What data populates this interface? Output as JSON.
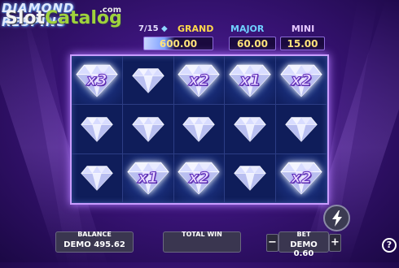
{
  "logo": {
    "game_title": "DIAMOND RESPINS",
    "watermark_part1": "Slot",
    "watermark_part2": "Catalog",
    "watermark_domain": ".com"
  },
  "jackpots": {
    "counter_current": "7/15",
    "counter_icon": "diamond-icon",
    "grand_label": "GRAND",
    "grand_value": "600.00",
    "major_label": "MAJOR",
    "major_value": "60.00",
    "mini_label": "MINI",
    "mini_value": "15.00",
    "accent_colors": {
      "grand": "#ffd84a",
      "major": "#6fd0ff",
      "mini": "#e5c7ff",
      "values": "#ffe37a"
    }
  },
  "grid": {
    "rows": [
      [
        {
          "lit": true,
          "mult": "x3"
        },
        {
          "lit": false,
          "mult": ""
        },
        {
          "lit": true,
          "mult": "x2"
        },
        {
          "lit": true,
          "mult": "x1"
        },
        {
          "lit": true,
          "mult": "x2"
        }
      ],
      [
        {
          "lit": false,
          "mult": ""
        },
        {
          "lit": false,
          "mult": ""
        },
        {
          "lit": false,
          "mult": ""
        },
        {
          "lit": false,
          "mult": ""
        },
        {
          "lit": false,
          "mult": ""
        }
      ],
      [
        {
          "lit": false,
          "mult": ""
        },
        {
          "lit": true,
          "mult": "x1"
        },
        {
          "lit": true,
          "mult": "x2"
        },
        {
          "lit": false,
          "mult": ""
        },
        {
          "lit": true,
          "mult": "x2"
        }
      ]
    ]
  },
  "bottom": {
    "balance_label": "BALANCE",
    "balance_value": "DEMO 495.62",
    "total_win_label": "TOTAL WIN",
    "total_win_value": "",
    "bet_label": "BET",
    "bet_value": "DEMO 0.60",
    "bet_minus": "−",
    "bet_plus": "+",
    "turbo_icon": "lightning-icon",
    "help_label": "?"
  }
}
